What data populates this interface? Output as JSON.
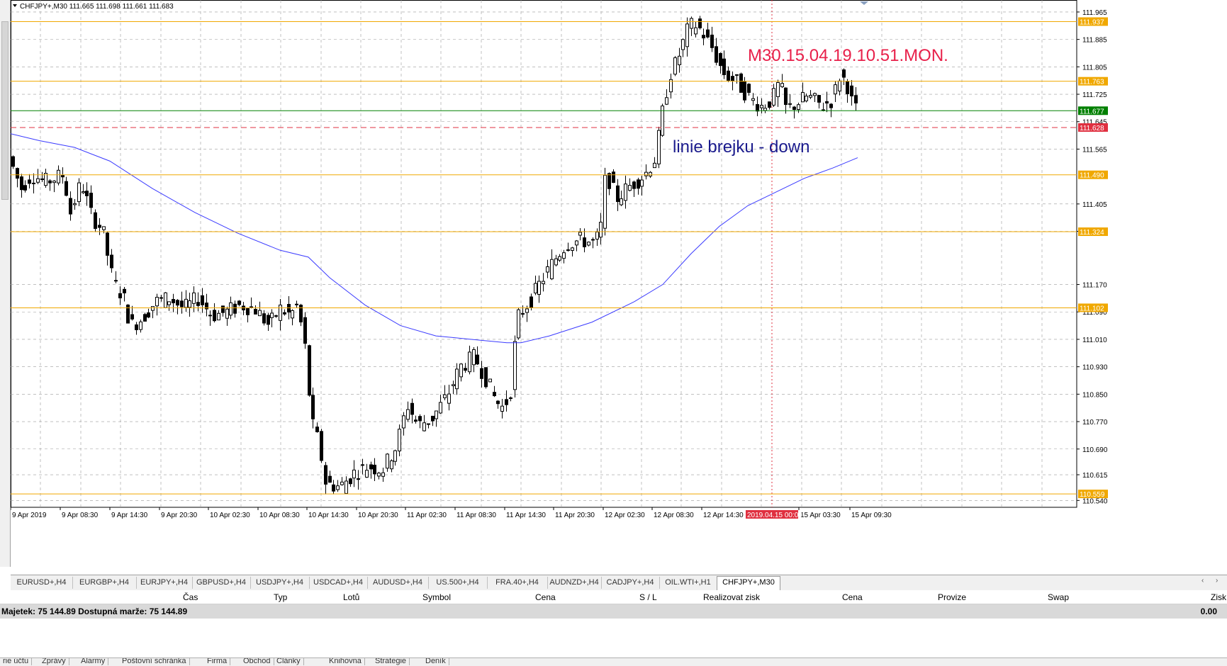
{
  "window": {
    "symbol_header": "CHFJPY+,M30",
    "ohlc": "111.665 111.698 111.661 111.683",
    "menu_arrow": "triangle-down-icon"
  },
  "chart": {
    "colors": {
      "grid": "#9a9a9a",
      "level_line": "#f0a800",
      "level_tag_bg": "#f0a800",
      "ma_line": "#3b3bff",
      "bid_line": "#008000",
      "ask_line": "#e03040",
      "candle": "#000000"
    },
    "annotation_title": "M30.15.04.19.10.51.MON.",
    "annotation_title_color": "#e8204a",
    "annotation_note": "linie brejku - down",
    "annotation_note_color": "#1a1a8c",
    "time_marker_label": "2019.04.15 00:00",
    "price_axis": [
      "111.965",
      "111.885",
      "111.805",
      "111.725",
      "111.645",
      "111.565",
      "111.405",
      "111.325",
      "111.170",
      "111.090",
      "111.010",
      "110.930",
      "110.850",
      "110.770",
      "110.690",
      "110.615",
      "110.540"
    ],
    "time_axis": [
      "9 Apr 2019",
      "9 Apr 08:30",
      "9 Apr 14:30",
      "9 Apr 20:30",
      "10 Apr 02:30",
      "10 Apr 08:30",
      "10 Apr 14:30",
      "10 Apr 20:30",
      "11 Apr 02:30",
      "11 Apr 08:30",
      "11 Apr 14:30",
      "11 Apr 20:30",
      "12 Apr 02:30",
      "12 Apr 08:30",
      "12 Apr 14:30",
      "15 Apr 03:30",
      "15 Apr 09:30"
    ],
    "horizontal_levels": [
      "111.937",
      "111.763",
      "111.490",
      "111.324",
      "111.102",
      "110.559"
    ],
    "bid_tag": "111.677",
    "ask_tag": "111.628"
  },
  "symbol_tabs": [
    "EURUSD+,H4",
    "EURGBP+,H4",
    "EURJPY+,H4",
    "GBPUSD+,H4",
    "USDJPY+,H4",
    "USDCAD+,H4",
    "AUDUSD+,H4",
    "US.500+,H4",
    "FRA.40+,H4",
    "AUDNZD+,H4",
    "CADJPY+,H4",
    "OIL.WTI+,H1",
    "CHFJPY+,M30"
  ],
  "active_tab": "CHFJPY+,M30",
  "tab_scroll": {
    "left": "‹",
    "right": "›"
  },
  "terminal": {
    "columns": [
      "Čas",
      "Typ",
      "Lotů",
      "Symbol",
      "Cena",
      "S / L",
      "Realizovat zisk",
      "Cena",
      "Provize",
      "Swap",
      "Zisk"
    ],
    "balance_text": "Majetek: 75 144.89  Dostupná marže: 75 144.89",
    "profit_total": "0.00"
  },
  "bottom_tabs": [
    "rie účtu",
    "Zprávy",
    "Alarmy",
    "Poštovní schránka",
    "Firma",
    "Obchod",
    "Články",
    "Knihovna",
    "Strategie",
    "Deník"
  ]
}
